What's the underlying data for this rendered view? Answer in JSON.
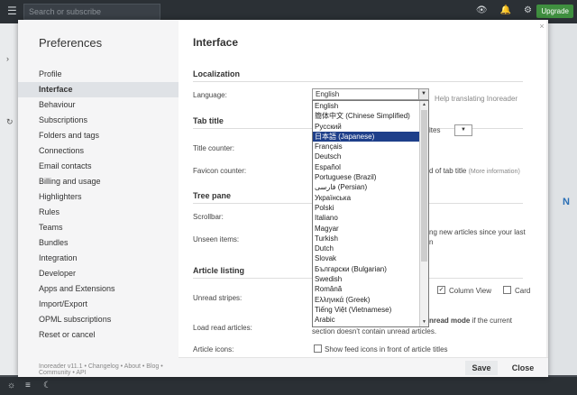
{
  "app": {
    "search_placeholder": "Search or subscribe",
    "upgrade_label": "Upgrade",
    "background_letter": "N"
  },
  "sidebar": {
    "title": "Preferences",
    "items": [
      {
        "label": "Profile"
      },
      {
        "label": "Interface"
      },
      {
        "label": "Behaviour"
      },
      {
        "label": "Subscriptions"
      },
      {
        "label": "Folders and tags"
      },
      {
        "label": "Connections"
      },
      {
        "label": "Email contacts"
      },
      {
        "label": "Billing and usage"
      },
      {
        "label": "Highlighters"
      },
      {
        "label": "Rules"
      },
      {
        "label": "Teams"
      },
      {
        "label": "Bundles"
      },
      {
        "label": "Integration"
      },
      {
        "label": "Developer"
      },
      {
        "label": "Apps and Extensions"
      },
      {
        "label": "Import/Export"
      },
      {
        "label": "OPML subscriptions"
      },
      {
        "label": "Reset or cancel"
      }
    ],
    "active_index": 1,
    "footer": "Inoreader v11.1 • Changelog • About • Blog • Community • API"
  },
  "content": {
    "title": "Interface",
    "localization": {
      "section": "Localization",
      "language_label": "Language:",
      "language_value": "English",
      "help_link": "Help translating Inoreader",
      "options": [
        "English",
        "簡体中文 (Chinese Simplified)",
        "Русский",
        "日本語 (Japanese)",
        "Français",
        "Deutsch",
        "Español",
        "Portuguese (Brazil)",
        "فارسی (Persian)",
        "Українська",
        "Polski",
        "Italiano",
        "Magyar",
        "Turkish",
        "Dutch",
        "Slovak",
        "Български (Bulgarian)",
        "Swedish",
        "Română",
        "Ελληνικά (Greek)",
        "Tiếng Việt (Vietnamese)",
        "Arabic"
      ],
      "highlighted_index": 3
    },
    "tab_title": {
      "section": "Tab title",
      "title_counter_label": "Title counter:",
      "title_counter_partial": "ites",
      "favicon_counter_label": "Favicon counter:",
      "favicon_partial": "d of tab title",
      "more_info": "(More information)"
    },
    "tree_pane": {
      "section": "Tree pane",
      "scrollbar_label": "Scrollbar:",
      "unseen_label": "Unseen items:",
      "unseen_partial_1": "ng new articles since your last",
      "unseen_partial_2": "n"
    },
    "article_listing": {
      "section": "Article listing",
      "unread_stripes_label": "Unread stripes:",
      "column_view": "Column View",
      "card": "Card",
      "load_read_label": "Load read articles:",
      "load_read_bold": "nread mode",
      "load_read_rest": " if the current",
      "load_read_line2": "section doesn't contain unread articles.",
      "article_icons_label": "Article icons:",
      "article_icons_text": "Show feed icons in front of article titles"
    }
  },
  "footer": {
    "save_label": "Save",
    "close_label": "Close"
  }
}
